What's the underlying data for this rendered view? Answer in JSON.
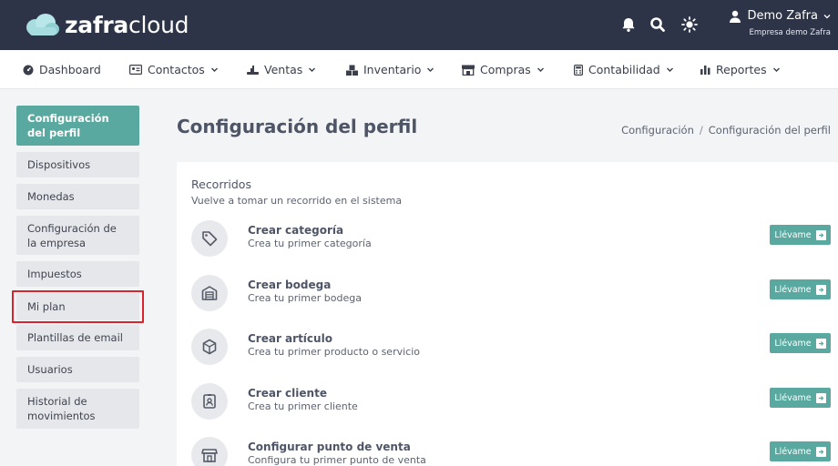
{
  "brand": {
    "logo_bold": "zafra",
    "logo_light": "cloud"
  },
  "user": {
    "name": "Demo Zafra",
    "company": "Empresa demo Zafra"
  },
  "nav": [
    {
      "label": "Dashboard",
      "icon": "dashboard-icon",
      "dropdown": false
    },
    {
      "label": "Contactos",
      "icon": "contacts-icon",
      "dropdown": true
    },
    {
      "label": "Ventas",
      "icon": "sales-icon",
      "dropdown": true
    },
    {
      "label": "Inventario",
      "icon": "inventory-icon",
      "dropdown": true
    },
    {
      "label": "Compras",
      "icon": "store-icon",
      "dropdown": true
    },
    {
      "label": "Contabilidad",
      "icon": "calculator-icon",
      "dropdown": true
    },
    {
      "label": "Reportes",
      "icon": "bar-chart-icon",
      "dropdown": true
    }
  ],
  "sidebar": {
    "items": [
      {
        "label": "Configuración del perfil",
        "active": true
      },
      {
        "label": "Dispositivos",
        "active": false
      },
      {
        "label": "Monedas",
        "active": false
      },
      {
        "label": "Configuración de la empresa",
        "active": false
      },
      {
        "label": "Impuestos",
        "active": false
      },
      {
        "label": "Mi plan",
        "active": false
      },
      {
        "label": "Plantillas de email",
        "active": false
      },
      {
        "label": "Usuarios",
        "active": false
      },
      {
        "label": "Historial de movimientos",
        "active": false
      }
    ]
  },
  "page": {
    "title": "Configuración del perfil",
    "breadcrumb": [
      "Configuración",
      "Configuración del perfil"
    ],
    "breadcrumb_sep": "/"
  },
  "tours": {
    "title": "Recorridos",
    "subtitle": "Vuelve a tomar un recorrido en el sistema",
    "button_label": "Llévame",
    "items": [
      {
        "title": "Crear categoría",
        "desc": "Crea tu primer categoría",
        "icon": "tag-icon"
      },
      {
        "title": "Crear bodega",
        "desc": "Crea tu primer bodega",
        "icon": "warehouse-icon"
      },
      {
        "title": "Crear artículo",
        "desc": "Crea tu primer producto o servicio",
        "icon": "box-icon"
      },
      {
        "title": "Crear cliente",
        "desc": "Crea tu primer cliente",
        "icon": "contact-card-icon"
      },
      {
        "title": "Configurar punto de venta",
        "desc": "Configura tu primer punto de venta",
        "icon": "store-icon"
      }
    ]
  },
  "colors": {
    "topbar": "#2d3447",
    "accent": "#5aa9a0",
    "highlight": "#d9232d"
  }
}
